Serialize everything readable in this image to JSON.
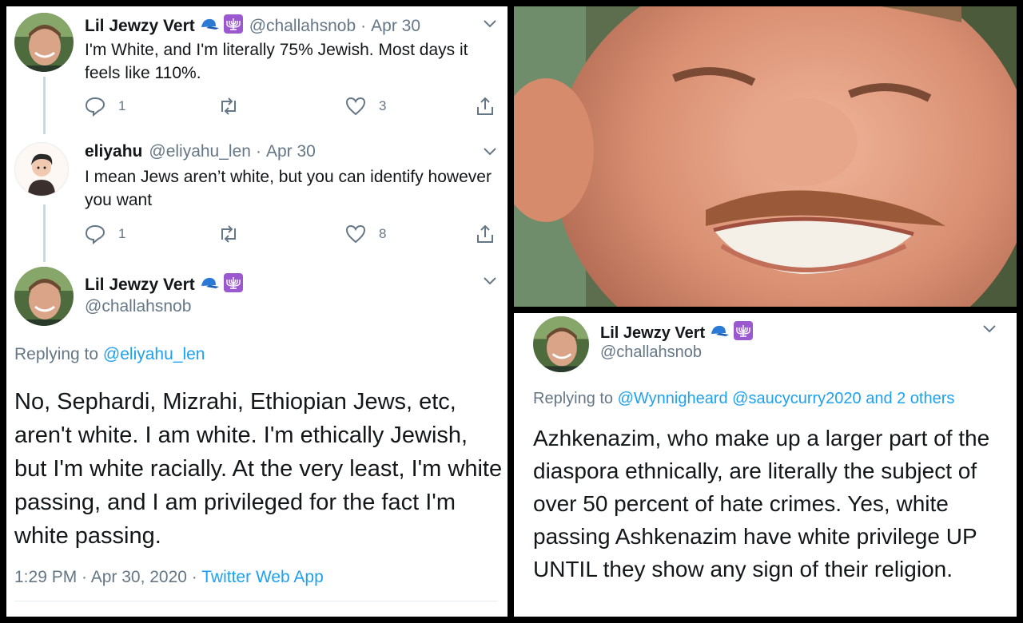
{
  "tweet1": {
    "display_name": "Lil Jewzy Vert",
    "handle": "@challahsnob",
    "date": "Apr 30",
    "text": "I'm White, and I'm literally 75% Jewish. Most days it feels like 110%.",
    "reply_count": "1",
    "like_count": "3"
  },
  "tweet2": {
    "display_name": "eliyahu",
    "handle": "@eliyahu_len",
    "date": "Apr 30",
    "text": "I mean Jews aren’t white, but you can identify however you want",
    "reply_count": "1",
    "like_count": "8"
  },
  "tweet3": {
    "display_name": "Lil Jewzy Vert",
    "handle": "@challahsnob",
    "replying_prefix": "Replying to",
    "replying_to": "@eliyahu_len",
    "text": "No, Sephardi, Mizrahi, Ethiopian Jews, etc, aren't white. I am white. I'm ethically Jewish, but I'm white racially. At the very least, I'm white passing, and I am privileged for the fact I'm white passing.",
    "time": "1:29 PM · Apr 30, 2020 ·",
    "source": "Twitter Web App"
  },
  "tweet4": {
    "display_name": "Lil Jewzy Vert",
    "handle": "@challahsnob",
    "replying_prefix": "Replying to",
    "replying_to": "@Wynnigheard @saucycurry2020 and 2 others",
    "text": "Azhkenazim, who make up a larger part of the diaspora ethnically, are literally the subject of over 50 percent of hate crimes. Yes, white passing Ashkenazim have white privilege UP UNTIL they show any sign of their religion."
  },
  "colors": {
    "link": "#1da1f2",
    "secondary_text": "#657786",
    "primary_text": "#14171a",
    "thread_line": "#ccd6dd"
  },
  "icons": [
    "reply-icon",
    "retweet-icon",
    "like-icon",
    "share-icon",
    "chevron-down-icon",
    "blue-cap-emoji",
    "menorah-emoji"
  ]
}
